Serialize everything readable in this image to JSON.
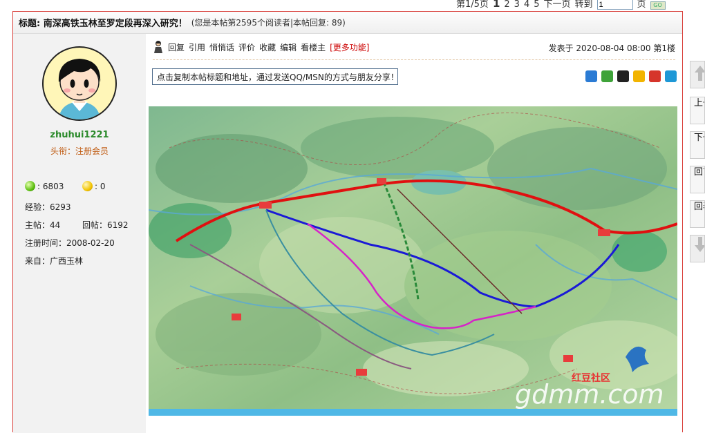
{
  "pager": {
    "page_info": "第1/5页",
    "pages": [
      "1",
      "2",
      "3",
      "4",
      "5"
    ],
    "next_label": "下一页",
    "goto_label": "转到",
    "goto_value": "1",
    "page_suffix": "页",
    "go_label": "GO"
  },
  "thread": {
    "title": "标题: 南深高铁玉林至罗定段再深入研究！",
    "subtitle": "(您是本帖第2595个阅读者|本帖回复: 89)"
  },
  "author": {
    "username": "zhuhui1221",
    "rank": "头衔：注册会员",
    "green_points": ": 6803",
    "yellow_points": ": 0",
    "experience": "经验：6293",
    "topics": "主帖：44",
    "replies": "回帖：6192",
    "registered": "注册时间：2008-02-20",
    "from": "来自：广西玉林"
  },
  "post": {
    "actions": [
      "回复",
      "引用",
      "悄悄话",
      "评价",
      "收藏",
      "编辑",
      "看楼主"
    ],
    "more_label": "[更多功能]",
    "posted": "发表于 2020-08-04 08:00 第1楼",
    "copy_text": "点击复制本帖标题和地址，通过发送QQ/MSN的方式与朋友分享！",
    "map_watermark": "gdmm.com",
    "map_logo_text": "红豆社区"
  },
  "share_icons": [
    "add-share-icon",
    "wechat-icon",
    "qq-icon",
    "qzone-icon",
    "weibo-icon",
    "other-share-icon"
  ],
  "share_colors": [
    "#2b7bd4",
    "#3fa33a",
    "#222222",
    "#f2b400",
    "#d6352b",
    "#1e98d6"
  ],
  "right_tools": {
    "up_topic": "上一主题",
    "down_topic": "下一主题",
    "home": "回首页",
    "back": "回表"
  },
  "colors": {
    "frame_border": "#d9403b",
    "username": "#2a8a2a",
    "rank": "#c05a10",
    "more_link": "#cc0000"
  }
}
